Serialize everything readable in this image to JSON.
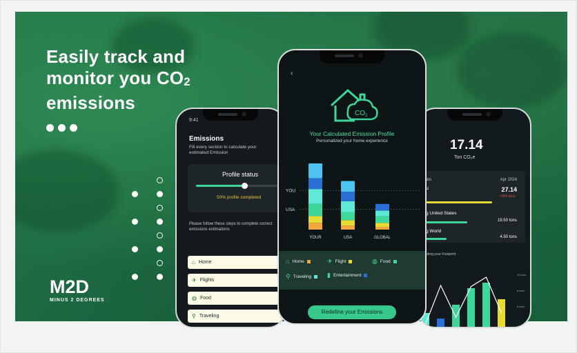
{
  "headline": {
    "line1": "Easily track and",
    "line2a": "monitor you CO",
    "line2sub": "2",
    "line3": "emissions"
  },
  "logo": {
    "mark": "M2D",
    "sub": "MINUS 2 DEGREES"
  },
  "colors": {
    "accent": "#3ed79a",
    "warning": "#e5c53f",
    "bg_green": "#1a6640"
  },
  "phone_left": {
    "time": "9:41",
    "title": "Emissions",
    "description": "Fill every section to calculate your estimated Emission",
    "profile_status": "Profile status",
    "profile_progress": 0.5,
    "profile_completed": "50% profile completed",
    "steps_text": "Please follow these steps to complete correct emissions estimations",
    "categories": [
      {
        "label": "Home",
        "icon": "home-icon",
        "status": "check"
      },
      {
        "label": "Flights",
        "icon": "plane-icon",
        "status": "warning"
      },
      {
        "label": "Food",
        "icon": "food-icon",
        "status": "warning"
      },
      {
        "label": "Traveling",
        "icon": "traveling-icon",
        "status": "warning"
      }
    ]
  },
  "phone_center": {
    "house_label": "CO",
    "house_label_sub": "2",
    "title": "Your Calculated Emission Profile",
    "subtitle": "Personalized your home experience",
    "ref_you": "YOU",
    "ref_usa": "USA",
    "legend": [
      {
        "label": "Home",
        "icon": "home-icon",
        "color": "#f5a53d"
      },
      {
        "label": "Flight",
        "icon": "plane-icon",
        "color": "#e5db33"
      },
      {
        "label": "Food",
        "icon": "food-icon",
        "color": "#3ed79a"
      },
      {
        "label": "Traveling",
        "icon": "traveling-icon",
        "color": "#5ee8d8"
      },
      {
        "label": "Entertainment",
        "icon": "entertainment-icon",
        "color": "#2a6fd6"
      }
    ],
    "button": "Redefine your Emissions"
  },
  "chart_data": {
    "type": "bar",
    "categories": [
      "YOUR",
      "USA",
      "GLOBAL"
    ],
    "stacks": [
      {
        "category": "YOUR",
        "segments": [
          {
            "color": "#f5a53d",
            "value": 10
          },
          {
            "color": "#e5db33",
            "value": 10
          },
          {
            "color": "#3ed79a",
            "value": 18
          },
          {
            "color": "#5ee8d8",
            "value": 22
          },
          {
            "color": "#2a6fd6",
            "value": 16
          },
          {
            "color": "#4cc4f0",
            "value": 22
          }
        ]
      },
      {
        "category": "USA",
        "segments": [
          {
            "color": "#f5a53d",
            "value": 6
          },
          {
            "color": "#e5db33",
            "value": 8
          },
          {
            "color": "#3ed79a",
            "value": 12
          },
          {
            "color": "#5ee8d8",
            "value": 16
          },
          {
            "color": "#2a6fd6",
            "value": 14
          },
          {
            "color": "#4cc4f0",
            "value": 16
          }
        ]
      },
      {
        "category": "GLOBAL",
        "segments": [
          {
            "color": "#f5a53d",
            "value": 4
          },
          {
            "color": "#e5db33",
            "value": 6
          },
          {
            "color": "#3ed79a",
            "value": 10
          },
          {
            "color": "#5ee8d8",
            "value": 8
          },
          {
            "color": "#2a6fd6",
            "value": 10
          }
        ]
      }
    ],
    "reference_lines": [
      {
        "label": "YOU",
        "value": 58
      },
      {
        "label": "USA",
        "value": 30
      }
    ],
    "ylim": [
      0,
      100
    ],
    "grid": false,
    "legend": "bottom"
  },
  "phone_right": {
    "total": "17.14",
    "unit": "Ton CO₂e",
    "stats_title": "ats",
    "date": "Apr 2024",
    "you_short": "u",
    "you_value": "27.14",
    "you_change": "+9% tons",
    "you_progress": 0.67,
    "usa_label": "g United States",
    "usa_value": "19.50 tons",
    "usa_progress": 0.42,
    "world_label": "g World",
    "world_value": "4.50 tons",
    "world_progress": 0.21,
    "footprint_caption": "standing your Footprint",
    "chart_tick_10": "10 tons",
    "chart_tick_8": "8 tons",
    "chart_tick_6": "6 tons",
    "bars": [
      {
        "value": 3.0,
        "color": "#5ee8d8"
      },
      {
        "value": 2.0,
        "color": "#2a6fd6"
      },
      {
        "value": 4.5,
        "color": "#3ed79a"
      },
      {
        "value": 7.5,
        "color": "#3ed79a"
      },
      {
        "value": 8.5,
        "color": "#3ed79a"
      },
      {
        "value": 5.5,
        "color": "#e5db33"
      }
    ],
    "line": [
      1.0,
      8.0,
      2.2,
      7.8,
      9.5,
      3.0
    ]
  }
}
